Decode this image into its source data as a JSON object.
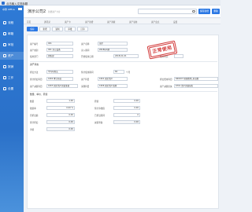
{
  "app": {
    "window_title": "点击输入文档标题"
  },
  "sidebar": {
    "brand": "卓锋 Office",
    "items": [
      {
        "label": "流程"
      },
      {
        "label": "邮箱"
      },
      {
        "label": "审批"
      },
      {
        "label": "资产"
      },
      {
        "label": "报销"
      },
      {
        "label": "工作"
      },
      {
        "label": "设置"
      }
    ]
  },
  "header": {
    "doc_title": "演示公司2",
    "doc_sub": "新增资产卡片",
    "search_placeholder": "",
    "primary_button": "保存新增",
    "secondary_button": "删除"
  },
  "navtabs": [
    "首页",
    "通讯录",
    "资产卡",
    "资产新增",
    "资产调拨",
    "资产领用",
    "资产盘点",
    "设置"
  ],
  "toolbar": {
    "buttons": [
      "保存",
      "新增",
      "复制",
      "审批",
      "打印"
    ]
  },
  "form": {
    "row1": {
      "label_a": "资产编号",
      "value_a": "001",
      "label_b": "资产名称",
      "value_b": "演示"
    },
    "row2": {
      "label_a": "资产类别",
      "value_a": "001 办公设备",
      "label_b": "录入期间",
      "value_b": "2018年1期"
    },
    "row3": {
      "label_a": "使用部门",
      "value_a": "销售部",
      "label_b": "开始使用日期",
      "value_b": "2018-01-01",
      "label_c": "使用状况",
      "value_c": ""
    },
    "section2": "资产状态",
    "row4": {
      "label_a": "折旧方法",
      "value_a": "平均年限法",
      "label_b": "预计使用期间",
      "value_b": "60",
      "value_b2": "个月"
    },
    "row5": {
      "label_a": "累计折旧科目",
      "value_a": "1602 累计折旧",
      "label_b": "资产科目",
      "value_b": "1601 固定资产",
      "label_c": "折旧费用科目",
      "value_c": "660203 管理费用_折旧费"
    },
    "row6": {
      "label_a": "资产减值科目",
      "value_a": "1603 固定资产减值准备",
      "label_b": "清理科目",
      "value_b": "1606 固定资产清理",
      "label_c": "资产减值损失",
      "value_c": "6701 资产减值损失"
    },
    "section3": "数量、单价、原值",
    "row7": {
      "label_a": "数量",
      "value_a": "1.00",
      "label_b": "原值",
      "value_b": "0.00"
    },
    "row8": {
      "label_a": "残值率",
      "value_a": "0.00 %",
      "label_b": "预计净残值",
      "value_b": "0.00"
    },
    "row9": {
      "label_a": "月折旧额",
      "value_a": "0.00",
      "label_b": "已折旧期间",
      "value_b": "0"
    },
    "row10": {
      "label_a": "累计折旧",
      "value_a": "0.00",
      "label_b": "减值准备",
      "value_b": "0.00"
    },
    "row11": {
      "label_a": "净值",
      "value_a": "0.00",
      "label_b": "",
      "value_b": ""
    }
  },
  "stamp": {
    "text": "正常使用",
    "color": "#d23a3a"
  },
  "colors": {
    "accent": "#2b78e4",
    "sidebar": "#2e7ad6"
  }
}
